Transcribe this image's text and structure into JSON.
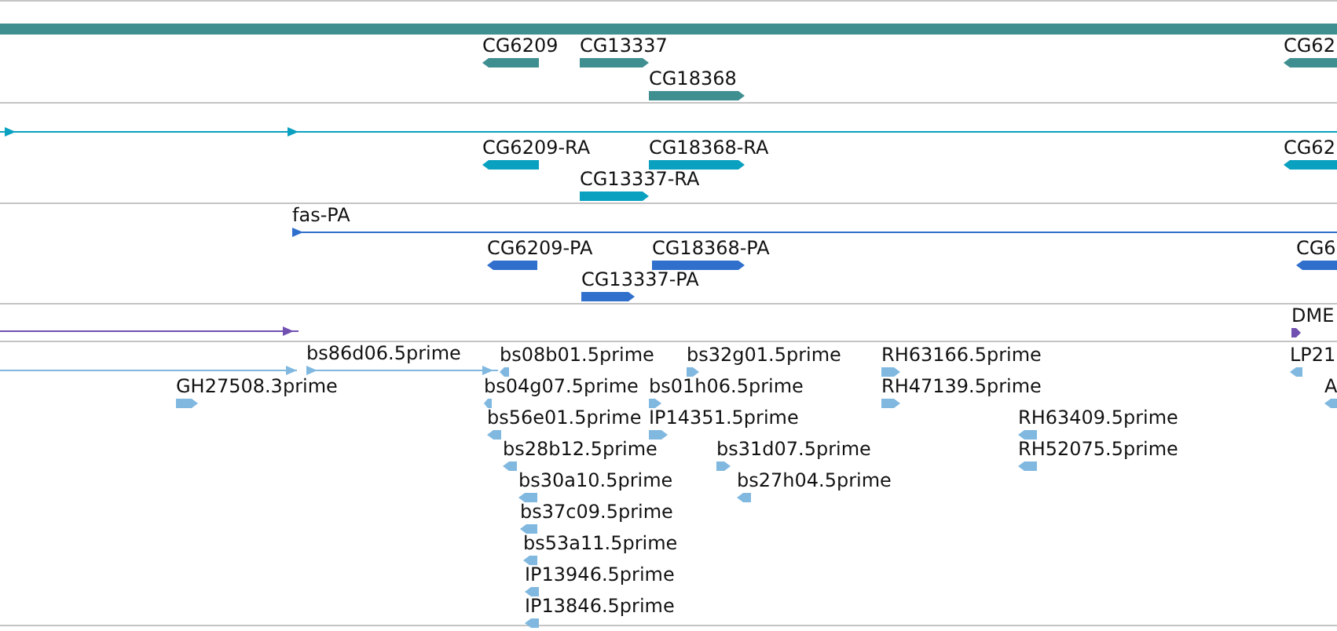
{
  "tracks": [
    {
      "color": "#3f8f91",
      "features": [
        {
          "kind": "band"
        },
        {
          "kind": "block",
          "label": "CG6209",
          "reverse": true
        },
        {
          "kind": "block",
          "label": "CG13337",
          "reverse": false
        },
        {
          "kind": "block",
          "label": "CG18368",
          "reverse": false
        },
        {
          "kind": "block",
          "label": "CG62",
          "reverse": true
        }
      ]
    },
    {
      "color": "#0aa0c0",
      "features": [
        {
          "kind": "line",
          "reverse": false
        },
        {
          "kind": "block",
          "label": "CG6209-RA",
          "reverse": true
        },
        {
          "kind": "block",
          "label": "CG18368-RA",
          "reverse": false
        },
        {
          "kind": "block",
          "label": "CG13337-RA",
          "reverse": false
        },
        {
          "kind": "block",
          "label": "CG62",
          "reverse": true
        }
      ]
    },
    {
      "color": "#3070cc",
      "features": [
        {
          "kind": "line",
          "label": "fas-PA",
          "reverse": false
        },
        {
          "kind": "block",
          "label": "CG6209-PA",
          "reverse": true
        },
        {
          "kind": "block",
          "label": "CG18368-PA",
          "reverse": false
        },
        {
          "kind": "block",
          "label": "CG13337-PA",
          "reverse": false
        },
        {
          "kind": "block",
          "label": "CG6",
          "reverse": true
        }
      ]
    },
    {
      "color": "#7050b0",
      "features": [
        {
          "kind": "line",
          "reverse": false
        },
        {
          "kind": "block",
          "label": "DME",
          "reverse": false
        }
      ]
    },
    {
      "color": "#80b8e0",
      "features": [
        {
          "kind": "line",
          "reverse": false
        },
        {
          "kind": "line",
          "label": "bs86d06.5prime",
          "reverse": false
        },
        {
          "kind": "block",
          "label": "bs08b01.5prime",
          "reverse": true
        },
        {
          "kind": "block",
          "label": "bs32g01.5prime",
          "reverse": false
        },
        {
          "kind": "block",
          "label": "RH63166.5prime",
          "reverse": false
        },
        {
          "kind": "block",
          "label": "LP21",
          "reverse": true
        },
        {
          "kind": "block",
          "label": "GH27508.3prime",
          "reverse": false
        },
        {
          "kind": "block",
          "label": "bs04g07.5prime",
          "reverse": true
        },
        {
          "kind": "block",
          "label": "bs01h06.5prime",
          "reverse": false
        },
        {
          "kind": "block",
          "label": "RH47139.5prime",
          "reverse": false
        },
        {
          "kind": "block",
          "label": "A",
          "reverse": true
        },
        {
          "kind": "block",
          "label": "bs56e01.5prime",
          "reverse": true
        },
        {
          "kind": "block",
          "label": "IP14351.5prime",
          "reverse": false
        },
        {
          "kind": "block",
          "label": "RH63409.5prime",
          "reverse": true
        },
        {
          "kind": "block",
          "label": "bs28b12.5prime",
          "reverse": true
        },
        {
          "kind": "block",
          "label": "bs31d07.5prime",
          "reverse": false
        },
        {
          "kind": "block",
          "label": "RH52075.5prime",
          "reverse": true
        },
        {
          "kind": "block",
          "label": "bs30a10.5prime",
          "reverse": true
        },
        {
          "kind": "block",
          "label": "bs27h04.5prime",
          "reverse": true
        },
        {
          "kind": "block",
          "label": "bs37c09.5prime",
          "reverse": true
        },
        {
          "kind": "block",
          "label": "bs53a11.5prime",
          "reverse": true
        },
        {
          "kind": "block",
          "label": "IP13946.5prime",
          "reverse": true
        },
        {
          "kind": "block",
          "label": "IP13846.5prime",
          "reverse": true
        }
      ]
    }
  ]
}
